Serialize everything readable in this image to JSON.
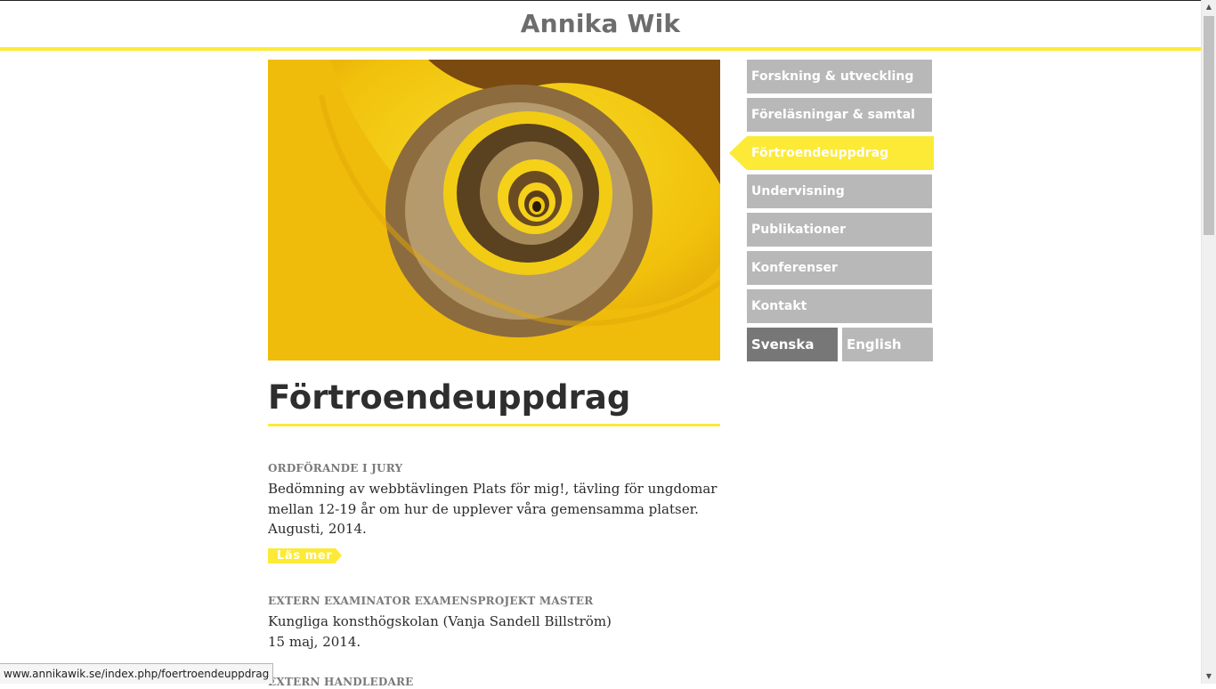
{
  "site": {
    "title": "Annika Wik"
  },
  "page": {
    "title": "Förtroendeuppdrag"
  },
  "nav": {
    "items": [
      {
        "label": "Forskning & utveckling"
      },
      {
        "label": "Föreläsningar & samtal"
      },
      {
        "label": "Förtroendeuppdrag",
        "active": true
      },
      {
        "label": "Undervisning"
      },
      {
        "label": "Publikationer"
      },
      {
        "label": "Konferenser"
      },
      {
        "label": "Kontakt"
      }
    ],
    "languages": [
      {
        "label": "Svenska",
        "current": true
      },
      {
        "label": "English"
      }
    ]
  },
  "entries": [
    {
      "heading": "Ordförande i jury",
      "lines": [
        "Bedömning av webbtävlingen Plats för mig!, tävling för ungdomar",
        "mellan 12-19 år om hur de upplever våra gemensamma platser.",
        "Augusti, 2014."
      ],
      "read_more": "Läs mer"
    },
    {
      "heading": "Extern examinator examensprojekt master",
      "lines": [
        "Kungliga konsthögskolan (Vanja Sandell Billström)",
        "15 maj, 2014."
      ]
    },
    {
      "heading": "Extern handledare"
    }
  ],
  "status_bar": {
    "url": "www.annikawik.se/index.php/foertroendeuppdrag"
  },
  "colors": {
    "accent": "#fcea37",
    "nav_bg": "#b8b8b8",
    "lang_current": "#777777"
  }
}
